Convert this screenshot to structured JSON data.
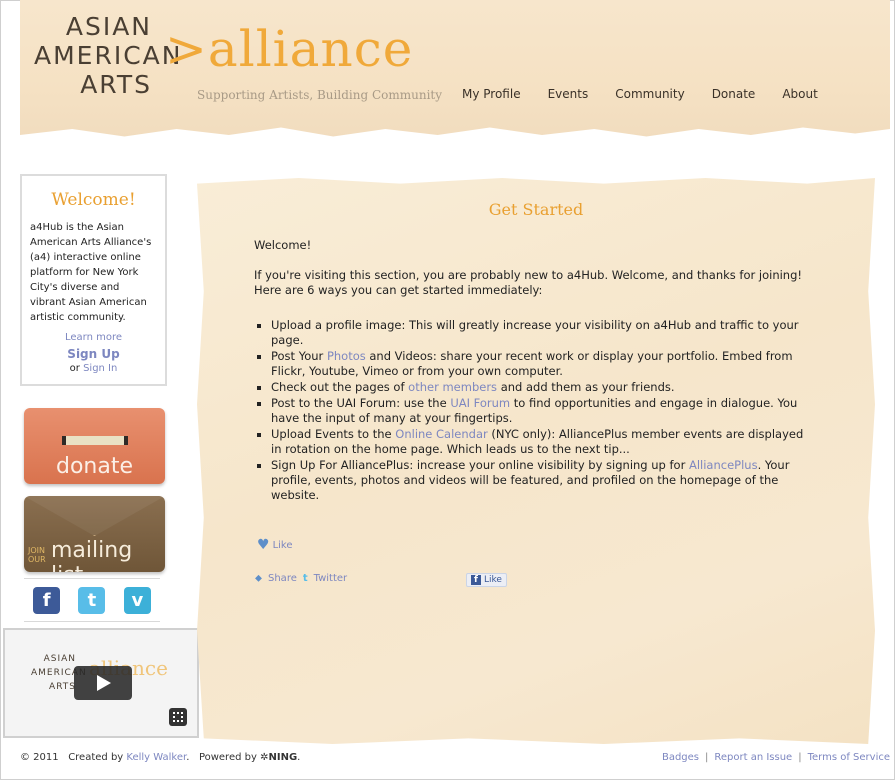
{
  "header": {
    "logo_lines": [
      "ASIAN",
      "AMERICAN",
      "ARTS"
    ],
    "logo_alliance": ">alliance",
    "tagline": "Supporting Artists, Building Community",
    "nav": [
      "My Profile",
      "Events",
      "Community",
      "Donate",
      "About"
    ]
  },
  "sidebar": {
    "welcome_title": "Welcome!",
    "welcome_text": "a4Hub is the Asian American Arts Alliance's (a4) interactive online platform for New York City's diverse and vibrant Asian American artistic community.",
    "learn_more": "Learn more",
    "sign_up": "Sign Up",
    "or_text": "or",
    "sign_in": "Sign In",
    "donate_label": "donate",
    "mail_join": [
      "JOIN",
      "OUR"
    ],
    "mail_label": "mailing list",
    "social": [
      {
        "name": "facebook",
        "glyph": "f"
      },
      {
        "name": "twitter",
        "glyph": "t"
      },
      {
        "name": "vimeo",
        "glyph": "v"
      }
    ],
    "video": {
      "logo_lines": [
        "ASIAN",
        "AMERICAN",
        "ARTS"
      ],
      "alliance": "alliance"
    }
  },
  "main": {
    "heading": "Get Started",
    "greeting": "Welcome!",
    "intro": "If you're visiting this section, you are probably new to a4Hub. Welcome, and thanks for joining! Here are 6 ways you can get started immediately:",
    "items": [
      {
        "before": "Upload a profile image: This will greatly increase your visibility on a4Hub and traffic to your page.",
        "link": "",
        "after": ""
      },
      {
        "before": "Post Your ",
        "link": "Photos",
        "after": " and Videos: share your recent work or display your portfolio. Embed from Flickr, Youtube, Vimeo or from your own computer."
      },
      {
        "before": "Check out the pages of ",
        "link": "other members",
        "after": " and add them as your friends."
      },
      {
        "before": "Post to the UAI Forum: use the ",
        "link": "UAI Forum",
        "after": " to find opportunities and engage in dialogue. You have the input of many at your fingertips."
      },
      {
        "before": "Upload Events to the ",
        "link": "Online Calendar",
        "after": " (NYC only): AlliancePlus member events are displayed in rotation on the home page. Which leads us to the next tip..."
      },
      {
        "before": "Sign Up For AlliancePlus: increase your online visibility by signing up for ",
        "link": "AlliancePlus",
        "after": ". Your profile, events, photos and videos will be featured, and profiled on the homepage of the website."
      }
    ],
    "like_label": "Like",
    "share_label": "Share",
    "twitter_label": "Twitter",
    "fb_like_label": "Like"
  },
  "footer": {
    "copyright": "© 2011",
    "created_by": "Created by",
    "author": "Kelly Walker",
    "powered_by": "Powered by",
    "ning": "NING",
    "links": [
      "Badges",
      "Report an Issue",
      "Terms of Service"
    ]
  },
  "colors": {
    "accent": "#e9a031",
    "link": "#7d87c0"
  }
}
